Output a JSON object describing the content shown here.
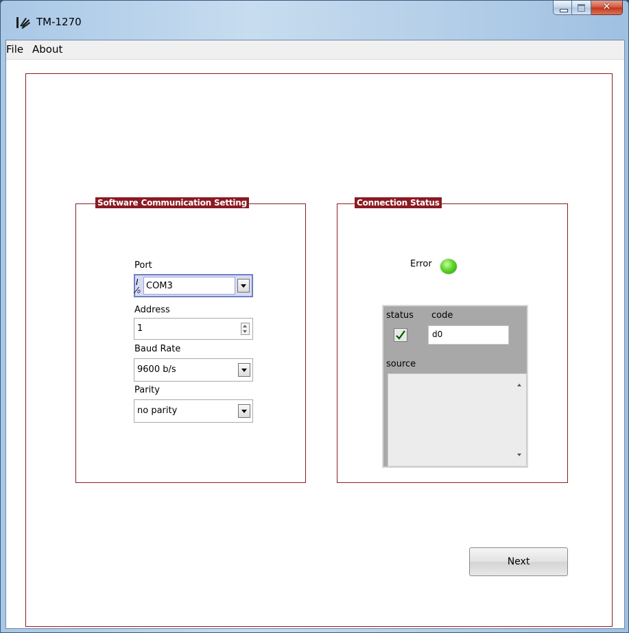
{
  "window": {
    "title": "TM-1270"
  },
  "menu": {
    "items": [
      "File",
      "About"
    ]
  },
  "comm_group": {
    "title": "Software Communication Setting",
    "port": {
      "label": "Port",
      "value": "COM3",
      "io_glyph": "I/0"
    },
    "address": {
      "label": "Address",
      "value": "1"
    },
    "baud": {
      "label": "Baud Rate",
      "value": "9600 b/s"
    },
    "parity": {
      "label": "Parity",
      "value": "no parity"
    }
  },
  "status_group": {
    "title": "Connection Status",
    "error_label": "Error",
    "led_color": "#5fd42b",
    "cluster": {
      "status_label": "status",
      "code_label": "code",
      "code_value": "d0",
      "source_label": "source",
      "source_value": ""
    }
  },
  "next_button": {
    "label": "Next"
  },
  "colors": {
    "accent": "#8b1a22"
  }
}
